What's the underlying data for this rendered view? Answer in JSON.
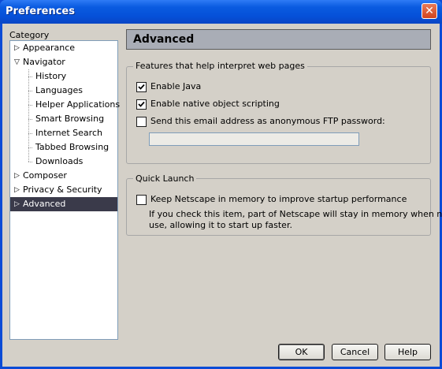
{
  "window": {
    "title": "Preferences",
    "close_glyph": "✕"
  },
  "sidebar": {
    "label": "Category",
    "items": [
      {
        "label": "Appearance",
        "expander": "▷"
      },
      {
        "label": "Navigator",
        "expander": "▽"
      },
      {
        "label": "History"
      },
      {
        "label": "Languages"
      },
      {
        "label": "Helper Applications"
      },
      {
        "label": "Smart Browsing"
      },
      {
        "label": "Internet Search"
      },
      {
        "label": "Tabbed Browsing"
      },
      {
        "label": "Downloads"
      },
      {
        "label": "Composer",
        "expander": "▷"
      },
      {
        "label": "Privacy & Security",
        "expander": "▷"
      },
      {
        "label": "Advanced",
        "expander": "▷",
        "selected": true
      }
    ]
  },
  "panel": {
    "title": "Advanced",
    "features": {
      "legend": "Features that help interpret web pages",
      "enable_java": {
        "label": "Enable Java",
        "checked": true
      },
      "native_scripting": {
        "label": "Enable native object scripting",
        "checked": true
      },
      "ftp_password": {
        "label": "Send this email address as anonymous FTP password:",
        "checked": false,
        "value": ""
      }
    },
    "quick_launch": {
      "legend": "Quick Launch",
      "keep_in_memory": {
        "label": "Keep Netscape in memory to improve startup performance",
        "checked": false
      },
      "description_line1": "If you check this item, part of Netscape will stay in memory when not in",
      "description_line2": "use, allowing it to start up faster."
    }
  },
  "buttons": {
    "ok": "OK",
    "cancel": "Cancel",
    "help": "Help"
  }
}
